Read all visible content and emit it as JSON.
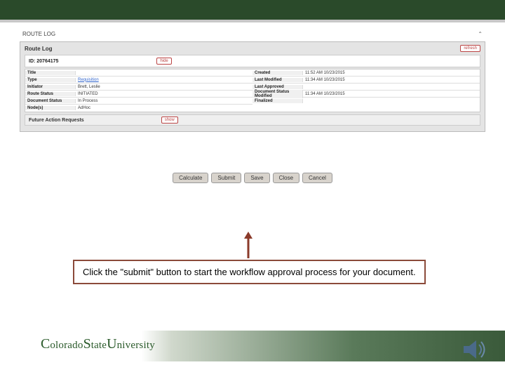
{
  "tabHeader": "ROUTE LOG",
  "routeLog": {
    "title": "Route Log",
    "refresh": "refresh",
    "id": "ID: 20764175",
    "hide": "hide",
    "left": [
      {
        "label": "Title",
        "value": ""
      },
      {
        "label": "Type",
        "value": "Requisition",
        "link": true
      },
      {
        "label": "Initiator",
        "value": "Brett, Leslie"
      },
      {
        "label": "Route Status",
        "value": "INITIATED"
      },
      {
        "label": "Document Status",
        "value": "In Process"
      },
      {
        "label": "Node(s)",
        "value": "AdHoc"
      }
    ],
    "right": [
      {
        "label": "Created",
        "value": "11:52 AM 10/23/2015"
      },
      {
        "label": "Last Modified",
        "value": "11:34 AM 10/23/2015"
      },
      {
        "label": "Last Approved",
        "value": ""
      },
      {
        "label": "Document Status Modified",
        "value": "11:34 AM 10/23/2015"
      },
      {
        "label": "Finalized",
        "value": ""
      }
    ],
    "futureLabel": "Future Action Requests",
    "show": "show"
  },
  "buttons": [
    "Calculate",
    "Submit",
    "Save",
    "Close",
    "Cancel"
  ],
  "callout": "Click the \"submit\" button to start the workflow approval process for your document.",
  "university": {
    "full": "Colorado State University"
  }
}
